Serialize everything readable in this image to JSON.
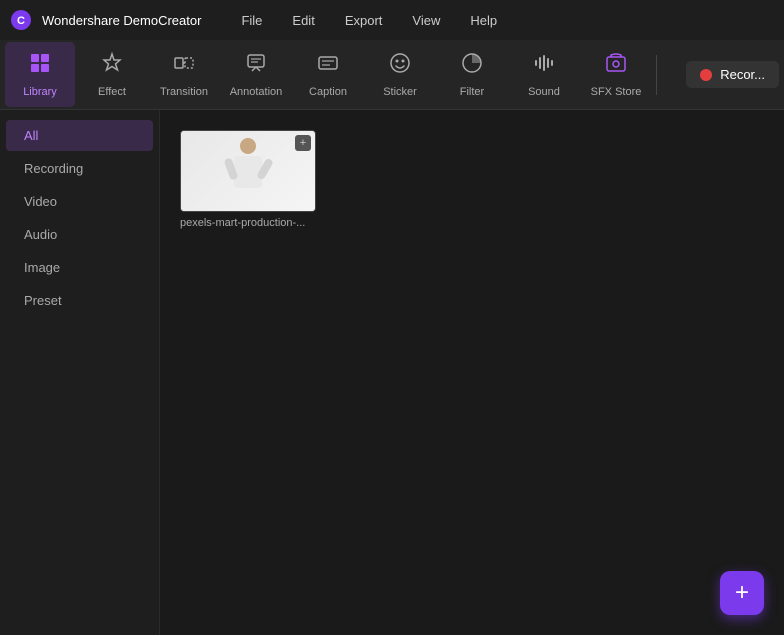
{
  "app": {
    "logo_label": "C",
    "title": "Wondershare DemoCreator"
  },
  "menu": {
    "items": [
      "File",
      "Edit",
      "Export",
      "View",
      "Help"
    ]
  },
  "toolbar": {
    "tools": [
      {
        "id": "library",
        "label": "Library",
        "active": true
      },
      {
        "id": "effect",
        "label": "Effect",
        "active": false
      },
      {
        "id": "transition",
        "label": "Transition",
        "active": false
      },
      {
        "id": "annotation",
        "label": "Annotation",
        "active": false
      },
      {
        "id": "caption",
        "label": "Caption",
        "active": false
      },
      {
        "id": "sticker",
        "label": "Sticker",
        "active": false
      },
      {
        "id": "filter",
        "label": "Filter",
        "active": false
      },
      {
        "id": "sound",
        "label": "Sound",
        "active": false
      },
      {
        "id": "sfx-store",
        "label": "SFX Store",
        "active": false
      }
    ],
    "record_label": "Recor..."
  },
  "sidebar": {
    "items": [
      {
        "id": "all",
        "label": "All",
        "active": true
      },
      {
        "id": "recording",
        "label": "Recording",
        "active": false
      },
      {
        "id": "video",
        "label": "Video",
        "active": false
      },
      {
        "id": "audio",
        "label": "Audio",
        "active": false
      },
      {
        "id": "image",
        "label": "Image",
        "active": false
      },
      {
        "id": "preset",
        "label": "Preset",
        "active": false
      }
    ]
  },
  "content": {
    "media_items": [
      {
        "name": "pexels-mart-production-...",
        "has_add_icon": true
      }
    ]
  },
  "fab": {
    "label": "+"
  }
}
